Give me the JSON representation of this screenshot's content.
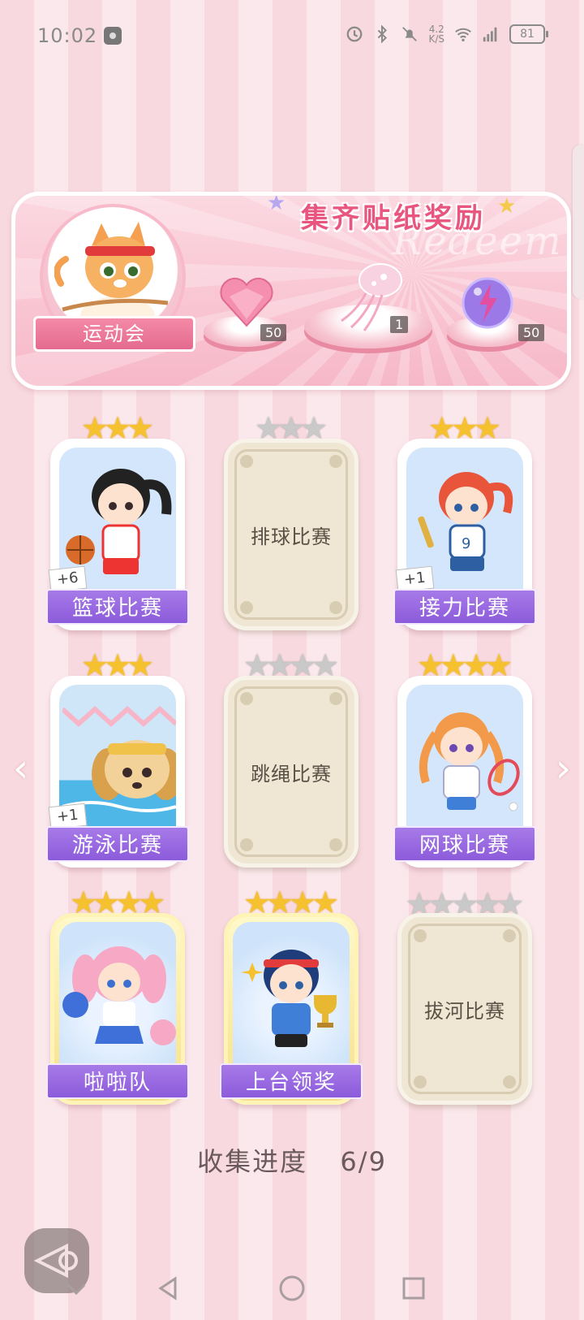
{
  "status_bar": {
    "time": "10:02",
    "net_speed_top": "4.2",
    "net_speed_bottom": "K/S",
    "battery": "81"
  },
  "reward_banner": {
    "title": "集齐贴纸奖励",
    "watermark": "Redeem",
    "badge_label": "运动会",
    "rewards": [
      {
        "icon": "pink-heart-gem-icon",
        "count": "50"
      },
      {
        "icon": "jellyfish-icon",
        "count": "1"
      },
      {
        "icon": "purple-lightning-orb-icon",
        "count": "50"
      }
    ]
  },
  "cards": [
    {
      "label": "篮球比赛",
      "collected": true,
      "stars": 3,
      "dup": "+6"
    },
    {
      "label": "排球比赛",
      "collected": false,
      "stars": 3
    },
    {
      "label": "接力比赛",
      "collected": true,
      "stars": 3,
      "dup": "+1"
    },
    {
      "label": "游泳比赛",
      "collected": true,
      "stars": 3,
      "dup": "+1"
    },
    {
      "label": "跳绳比赛",
      "collected": false,
      "stars": 4
    },
    {
      "label": "网球比赛",
      "collected": true,
      "stars": 4
    },
    {
      "label": "啦啦队",
      "collected": true,
      "stars": 4,
      "gold": true
    },
    {
      "label": "上台领奖",
      "collected": true,
      "stars": 4,
      "gold": true
    },
    {
      "label": "拔河比赛",
      "collected": false,
      "stars": 5
    }
  ],
  "progress": {
    "label": "收集进度",
    "value": "6/9"
  },
  "colors": {
    "accent_pink": "#e8557e",
    "label_purple": "#8c5bdb",
    "star_gold": "#f6c12e"
  }
}
